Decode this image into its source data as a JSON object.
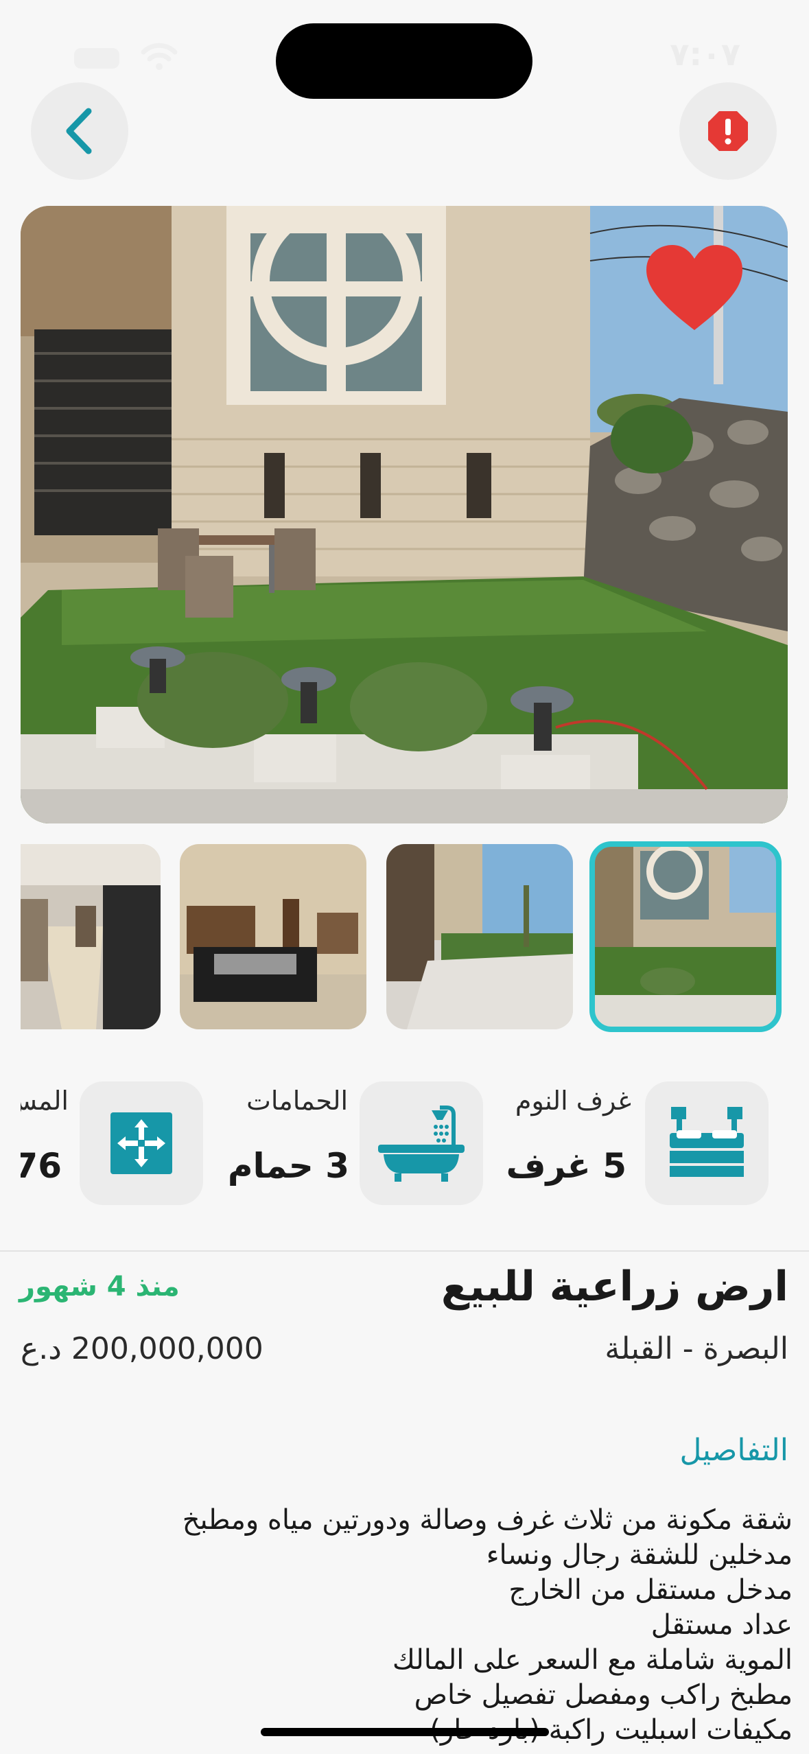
{
  "status_bar": {
    "time": "٧:٠٧"
  },
  "colors": {
    "accent": "#1797a8",
    "heart": "#e53935",
    "report": "#e53935",
    "time_ago": "#2bb573",
    "thumb_selected": "#2ec4cc"
  },
  "icons": {
    "back": "chevron-left-icon",
    "report": "alert-icon",
    "favorite": "heart-icon",
    "bedroom": "bed-icon",
    "bathroom": "bathtub-icon",
    "area": "expand-arrows-icon"
  },
  "gallery": {
    "thumbnail_count": 4,
    "selected_index": 0
  },
  "features": {
    "bedrooms": {
      "label": "غرف النوم",
      "value": "5 غرف"
    },
    "bathrooms": {
      "label": "الحمامات",
      "value": "3 حمام"
    },
    "area": {
      "label": "المس",
      "value": "76"
    }
  },
  "listing": {
    "title": "ارض زراعية  للبيع",
    "time_ago": "منذ 4 شهور",
    "location": "البصرة - القبلة",
    "price": "200,000,000 د.ع"
  },
  "details": {
    "heading": "التفاصيل",
    "lines": [
      "شقة مكونة من ثلاث غرف وصالة ودورتين مياه ومطبخ",
      "مدخلين للشقة رجال ونساء",
      "مدخل مستقل من الخارج",
      "عداد مستقل",
      "الموية شاملة مع السعر على المالك",
      "مطبخ راكب ومفصل تفصيل خاص",
      "مكيفات اسبليت راكبة (بارد حار)"
    ]
  }
}
